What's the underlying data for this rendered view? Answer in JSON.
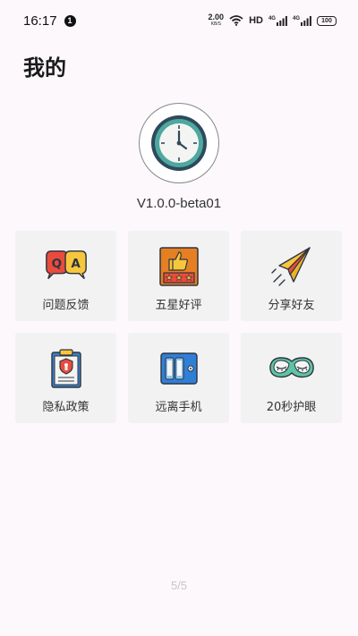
{
  "status_bar": {
    "time": "16:17",
    "notification_count": "1",
    "net_speed_value": "2.00",
    "net_speed_unit": "KB/S",
    "hd_label": "HD",
    "signal1_label": "4G",
    "signal2_label": "4G",
    "battery": "100"
  },
  "page": {
    "title": "我的",
    "version": "V1.0.0-beta01",
    "pager": "5/5"
  },
  "tiles": [
    {
      "label": "问题反馈",
      "icon": "qa-bubbles-icon"
    },
    {
      "label": "五星好评",
      "icon": "thumbs-up-stars-icon"
    },
    {
      "label": "分享好友",
      "icon": "paper-plane-icon"
    },
    {
      "label": "隐私政策",
      "icon": "privacy-document-icon"
    },
    {
      "label": "远离手机",
      "icon": "phone-locker-icon"
    },
    {
      "label": "20秒护眼",
      "icon": "eye-mask-icon"
    }
  ],
  "colors": {
    "background": "#fcf8fc",
    "tile_background": "#f2f2f3",
    "clock_face": "#4ea89f"
  }
}
